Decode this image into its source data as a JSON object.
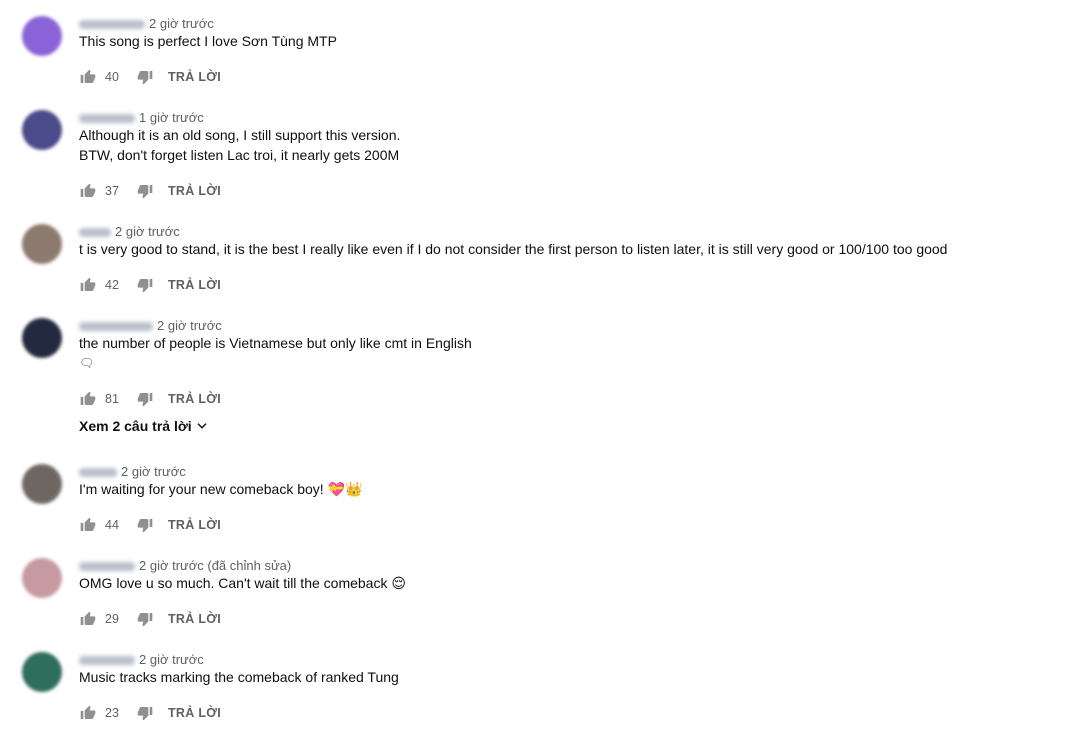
{
  "reply_label": "TRẢ LỜI",
  "comments": [
    {
      "time": "2 giờ trước",
      "lines": [
        "This song is perfect I love Sơn Tùng MTP"
      ],
      "likes": "40",
      "avatar_color": "#8a63d8"
    },
    {
      "time": "1 giờ trước",
      "lines": [
        "Although it is an old song, I still support this version.",
        "BTW, don't forget listen Lac troi, it nearly gets 200M"
      ],
      "likes": "37",
      "avatar_color": "#4b4a8a"
    },
    {
      "time": "2 giờ trước",
      "lines": [
        "t is very good to stand, it is the best I really like even if I do not consider the first person to listen later, it is still very good or 100/100 too good"
      ],
      "likes": "42",
      "avatar_color": "#8c7a6e"
    },
    {
      "time": "2 giờ trước",
      "lines": [
        "the number of people is Vietnamese but only like cmt in English",
        "🗨"
      ],
      "likes": "81",
      "avatar_color": "#232a3f"
    },
    {
      "time": "2 giờ trước",
      "lines": [
        "I'm waiting for your new comeback boy! 💝👑"
      ],
      "likes": "44",
      "avatar_color": "#6e6660"
    },
    {
      "time": "2 giờ trước (đã chỉnh sửa)",
      "lines": [
        "OMG love u so much. Can't wait till the comeback 😌"
      ],
      "likes": "29",
      "avatar_color": "#c79aa2"
    },
    {
      "time": "2 giờ trước",
      "lines": [
        "Music tracks marking the comeback of ranked Tung"
      ],
      "likes": "23",
      "avatar_color": "#2e6e5c"
    }
  ],
  "view_replies_label": "Xem 2 câu trả lời"
}
